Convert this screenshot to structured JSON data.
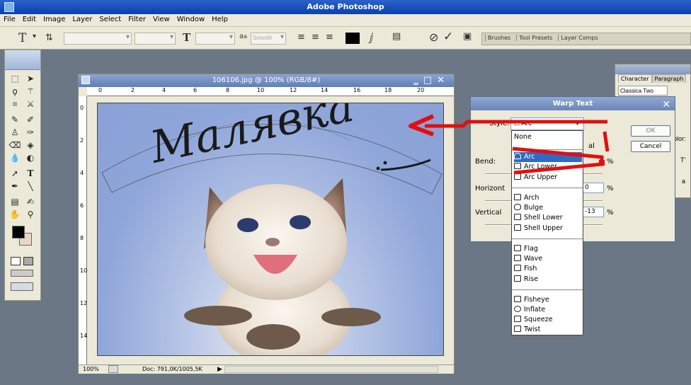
{
  "app": {
    "title": "Adobe Photoshop"
  },
  "menu": [
    "File",
    "Edit",
    "Image",
    "Layer",
    "Select",
    "Filter",
    "View",
    "Window",
    "Help"
  ],
  "options": {
    "tool_glyph": "T",
    "font_size_glyph": "T",
    "antialias_label": "a",
    "antialias_a": "a",
    "antialias_value": "Smooth",
    "palette_tabs": [
      "Brushes",
      "Tool Presets",
      "Layer Comps"
    ]
  },
  "document": {
    "title": "106106.jpg @ 100% (RGB/8#)",
    "ruler_h": [
      "0",
      "2",
      "4",
      "6",
      "8",
      "10",
      "12",
      "14",
      "16",
      "18",
      "20"
    ],
    "ruler_v": [
      "0",
      "2",
      "4",
      "6",
      "8",
      "10",
      "12",
      "14"
    ],
    "status_zoom": "100%",
    "status_doc": "Doc: 791,0K/1005,5K",
    "warped_text": "Малявка"
  },
  "character_panel": {
    "tabs": [
      "Character",
      "Paragraph"
    ],
    "font": "Classica Two",
    "partial": [
      "olor:",
      "T'",
      "a"
    ]
  },
  "warp_dialog": {
    "title": "Warp Text",
    "style_label": "Style:",
    "style_value": "Arc",
    "ok_label": "OK",
    "cancel_label": "Cancel",
    "bend_label": "Bend:",
    "bend_unit": "%",
    "horizontal_label": "Horizont",
    "horizontal_value": "0",
    "horizontal_unit": "%",
    "vertical_label": "Vertical",
    "vertical_value": "-13",
    "vertical_unit": "%",
    "behind_hint": "al"
  },
  "style_list": {
    "group0": [
      "None"
    ],
    "group1": [
      "Arc",
      "Arc Lower",
      "Arc Upper"
    ],
    "group2": [
      "Arch",
      "Bulge",
      "Shell Lower",
      "Shell Upper"
    ],
    "group3": [
      "Flag",
      "Wave",
      "Fish",
      "Rise"
    ],
    "group4": [
      "Fisheye",
      "Inflate",
      "Squeeze",
      "Twist"
    ]
  },
  "colors": {
    "annotation": "#e01010",
    "selection": "#316ac5"
  }
}
